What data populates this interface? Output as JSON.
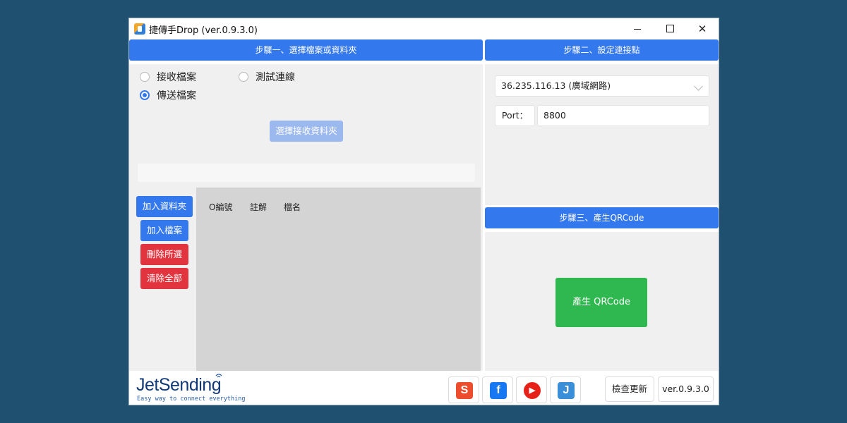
{
  "window": {
    "title": "捷傳手Drop  (ver.0.9.3.0)",
    "controls": {
      "minimize": "minimize",
      "maximize": "maximize",
      "close": "✕"
    }
  },
  "step1": {
    "header": "步驟一、選擇檔案或資料夾",
    "radios": [
      {
        "label": "接收檔案",
        "checked": false
      },
      {
        "label": "測試連線",
        "checked": false
      },
      {
        "label": "傳送檔案",
        "checked": true
      }
    ],
    "select_folder_button": "選擇接收資料夾",
    "path_value": "",
    "buttons": {
      "add_folder": "加入資料夾",
      "add_file": "加入檔案",
      "delete_selected": "刪除所選",
      "clear_all": "清除全部"
    },
    "columns": [
      "O編號",
      "註解",
      "檔名"
    ]
  },
  "step2": {
    "header": "步驟二、設定連接點",
    "address_value": "36.235.116.13 (廣域網路)",
    "port_label": "Port：",
    "port_value": "8800"
  },
  "step3": {
    "header": "步驟三、產生QRCode",
    "generate_button": "產生 QRCode"
  },
  "footer": {
    "logo_text": "JetSending",
    "logo_tagline": "Easy way to connect everything",
    "icons": [
      {
        "name": "shopee-icon",
        "glyph": "S",
        "color": "#ee4d2d"
      },
      {
        "name": "facebook-icon",
        "glyph": "f",
        "color": "#1877f2"
      },
      {
        "name": "youtube-icon",
        "glyph": "▶",
        "color": "#e62117"
      },
      {
        "name": "jet-icon",
        "glyph": "J",
        "color": "#3a8fd8"
      }
    ],
    "check_update_button": "檢查更新",
    "version_label": "ver.0.9.3.0"
  },
  "colors": {
    "accent": "#3478ee",
    "danger": "#e1343f",
    "success": "#2fb84f",
    "background": "#20506f"
  }
}
